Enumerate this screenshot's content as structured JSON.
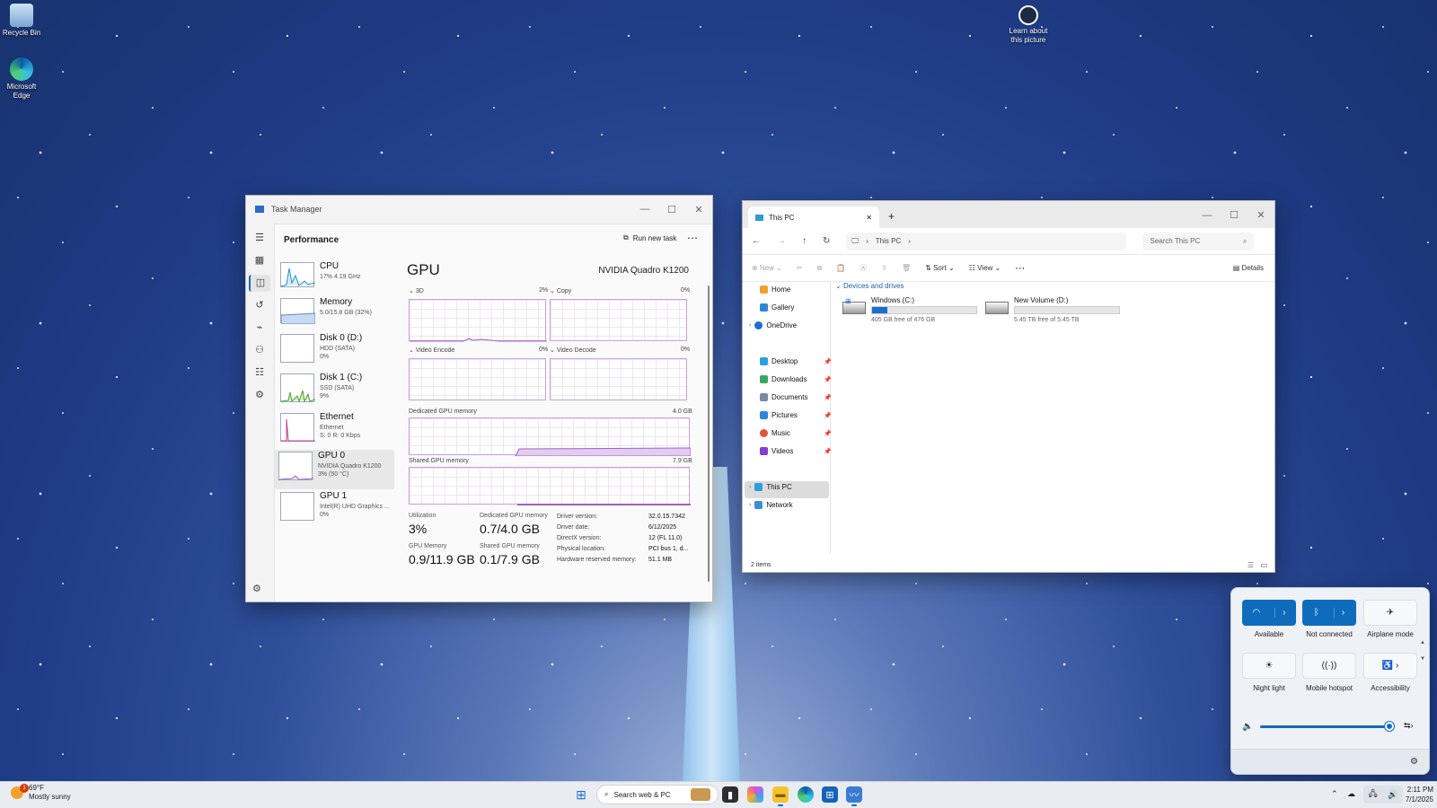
{
  "desktop": {
    "icons": [
      {
        "label": "Recycle Bin"
      },
      {
        "label": "Microsoft Edge"
      }
    ],
    "learn": "Learn about this picture"
  },
  "task_manager": {
    "title": "Task Manager",
    "section": "Performance",
    "run_new_task": "Run new task",
    "heading": "GPU",
    "gpu_name": "NVIDIA Quadro K1200",
    "list": [
      {
        "name": "CPU",
        "sub": "17%  4.19 GHz"
      },
      {
        "name": "Memory",
        "sub": "5.0/15.8 GB (32%)"
      },
      {
        "name": "Disk 0 (D:)",
        "sub": "HDD (SATA)",
        "sub2": "0%"
      },
      {
        "name": "Disk 1 (C:)",
        "sub": "SSD (SATA)",
        "sub2": "9%"
      },
      {
        "name": "Ethernet",
        "sub": "Ethernet",
        "sub2": "S: 0 R: 0 Kbps"
      },
      {
        "name": "GPU 0",
        "sub": "NVIDIA Quadro K1200",
        "sub2": "3% (50 °C)"
      },
      {
        "name": "GPU 1",
        "sub": "Intel(R) UHD Graphics ...",
        "sub2": "0%"
      }
    ],
    "graphs": {
      "g3d": {
        "label": "3D",
        "value": "2%"
      },
      "copy": {
        "label": "Copy",
        "value": "0%"
      },
      "encode": {
        "label": "Video Encode",
        "value": "0%"
      },
      "decode": {
        "label": "Video Decode",
        "value": "0%"
      },
      "dedicated": {
        "label": "Dedicated GPU memory",
        "value": "4.0 GB"
      },
      "shared": {
        "label": "Shared GPU memory",
        "value": "7.9 GB"
      }
    },
    "stats": {
      "utilization": {
        "label": "Utilization",
        "value": "3%"
      },
      "dedicated": {
        "label": "Dedicated GPU memory",
        "value": "0.7/4.0 GB"
      },
      "gpu_memory": {
        "label": "GPU Memory",
        "value": "0.9/11.9 GB"
      },
      "shared": {
        "label": "Shared GPU memory",
        "value": "0.1/7.9 GB"
      }
    },
    "info": [
      {
        "label": "Driver version:",
        "value": "32.0.15.7342"
      },
      {
        "label": "Driver date:",
        "value": "6/12/2025"
      },
      {
        "label": "DirectX version:",
        "value": "12 (FL 11.0)"
      },
      {
        "label": "Physical location:",
        "value": "PCI bus 1, d..."
      },
      {
        "label": "Hardware reserved memory:",
        "value": "51.1 MB"
      }
    ]
  },
  "explorer": {
    "tab": "This PC",
    "new_tab": "+",
    "breadcrumb": "This PC",
    "search_placeholder": "Search This PC",
    "toolbar": {
      "new": "New",
      "sort": "Sort",
      "view": "View",
      "details": "Details"
    },
    "nav": {
      "home": "Home",
      "gallery": "Gallery",
      "onedrive": "OneDrive",
      "desktop": "Desktop",
      "downloads": "Downloads",
      "documents": "Documents",
      "pictures": "Pictures",
      "music": "Music",
      "videos": "Videos",
      "thispc": "This PC",
      "network": "Network"
    },
    "group": "Devices and drives",
    "drives": [
      {
        "name": "Windows (C:)",
        "free": "405 GB free of 476 GB",
        "used_fraction": 0.15
      },
      {
        "name": "New Volume (D:)",
        "free": "5.45 TB free of 5.45 TB",
        "used_fraction": 0.0
      }
    ],
    "status": "2 items"
  },
  "quick_settings": {
    "tiles": [
      {
        "label": "Available"
      },
      {
        "label": "Not connected"
      },
      {
        "label": "Airplane mode"
      },
      {
        "label": "Night light"
      },
      {
        "label": "Mobile hotspot"
      },
      {
        "label": "Accessibility"
      }
    ],
    "volume_fraction": 0.96
  },
  "taskbar": {
    "weather_temp": "69°F",
    "weather_desc": "Mostly sunny",
    "weather_badge": "1",
    "search": "Search web & PC",
    "time": "2:11 PM",
    "date": "7/1/2025"
  },
  "colors": {
    "accent": "#0f6cbd",
    "gpu_purple": "#a35fc5"
  }
}
